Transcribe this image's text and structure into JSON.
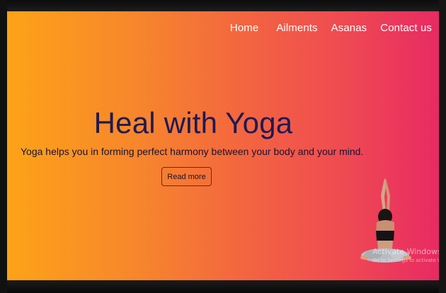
{
  "nav": {
    "items": [
      "Home",
      "Ailments",
      "Asanas",
      "Contact us"
    ]
  },
  "hero": {
    "title": "Heal with Yoga",
    "subtitle": "Yoga helps you in forming perfect harmony between your body and your mind.",
    "button_label": "Read more"
  },
  "watermark": {
    "line1": "Activate Windows",
    "line2": "Go to Settings to activate Windows."
  },
  "colors": {
    "gradient_start": "#fda317",
    "gradient_end": "#e82a63",
    "title_color": "#1e1a52",
    "nav_text": "#ffffff"
  }
}
